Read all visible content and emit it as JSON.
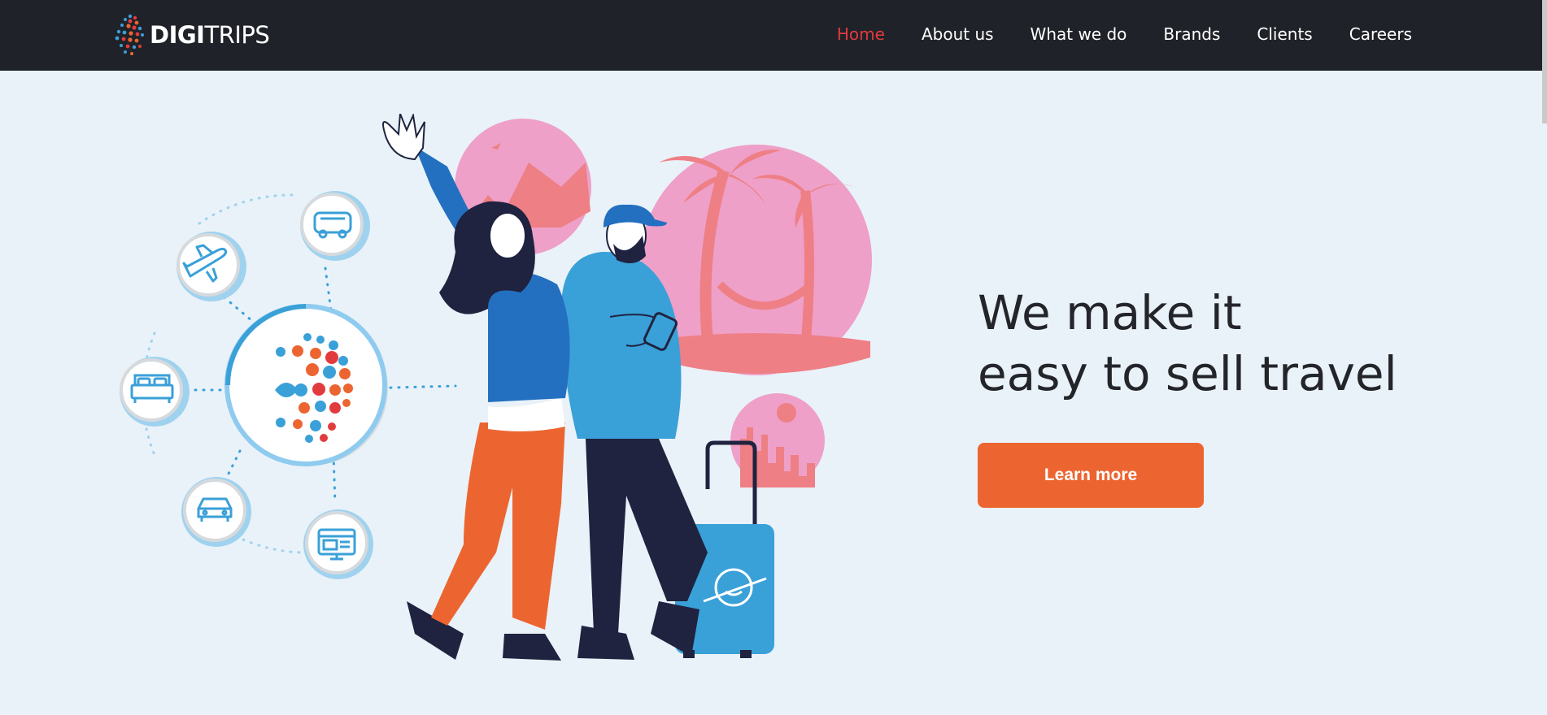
{
  "brand": {
    "name_bold": "DIGI",
    "name_light": "TRIPS",
    "colors": {
      "accent_red": "#e23b3e",
      "accent_orange": "#ec6531",
      "accent_blue": "#3aa0d8",
      "navbar": "#1f2228"
    }
  },
  "nav": {
    "items": [
      {
        "label": "Home",
        "active": true
      },
      {
        "label": "About us"
      },
      {
        "label": "What we do"
      },
      {
        "label": "Brands"
      },
      {
        "label": "Clients"
      },
      {
        "label": "Careers"
      }
    ]
  },
  "hero": {
    "title_line1": "We make it",
    "title_line2": "easy to sell travel",
    "cta_label": "Learn more"
  },
  "illustration": {
    "icons": [
      "bus-icon",
      "plane-icon",
      "bed-icon",
      "car-icon",
      "browser-icon",
      "digitrips-logo-icon"
    ],
    "scenes": [
      "mountain-scene",
      "palm-beach-scene",
      "city-skyline-scene"
    ],
    "people": [
      "woman-waving",
      "man-with-phone"
    ],
    "luggage": "suitcase"
  }
}
